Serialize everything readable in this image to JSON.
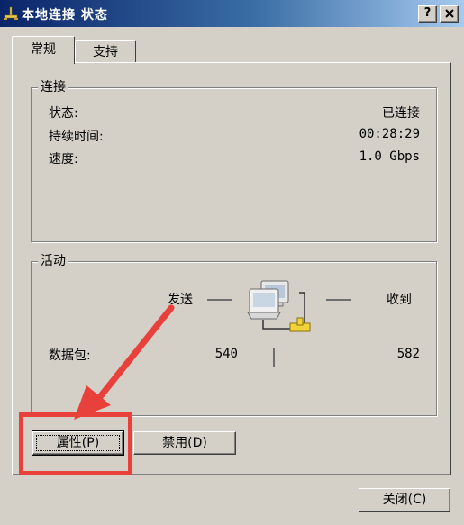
{
  "window": {
    "title": "本地连接 状态",
    "help_button": "?",
    "close_button": "X"
  },
  "tabs": [
    {
      "label": "常规",
      "active": true
    },
    {
      "label": "支持",
      "active": false
    }
  ],
  "connection": {
    "group_title": "连接",
    "rows": [
      {
        "label": "状态:",
        "value": "已连接"
      },
      {
        "label": "持续时间:",
        "value": "00:28:29"
      },
      {
        "label": "速度:",
        "value": "1.0 Gbps"
      }
    ]
  },
  "activity": {
    "group_title": "活动",
    "sent_label": "发送",
    "received_label": "收到",
    "packets_label": "数据包:",
    "packets_sent": "540",
    "packets_received": "582"
  },
  "buttons": {
    "properties": "属性(P)",
    "disable": "禁用(D)",
    "close": "关闭(C)"
  },
  "annotation": {
    "color": "#e8403a"
  },
  "colors": {
    "title_bar_start": "#0a246a",
    "title_bar_end": "#a6caf0",
    "face": "#d4d0c8"
  }
}
